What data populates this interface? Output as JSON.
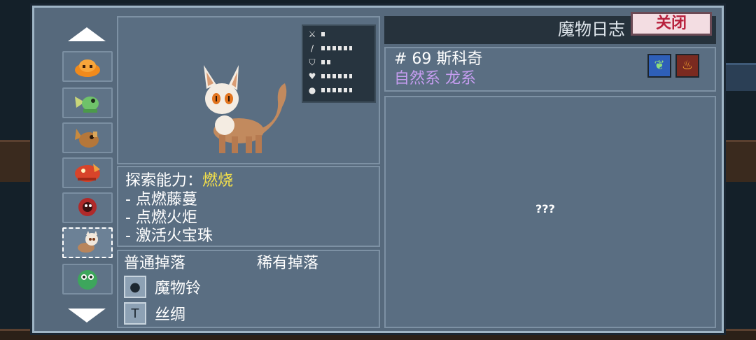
{
  "journal": {
    "title": "魔物日志",
    "close_label": "关闭"
  },
  "sidebar": {
    "monsters": [
      "orange-slime",
      "green-dragon",
      "brown-beast",
      "red-dragon",
      "red-tentacle-beast",
      "cat-monster",
      "green-owl"
    ],
    "selected_index": 5
  },
  "monster": {
    "number_name": "# 69 斯科奇",
    "types": "自然系 龙系",
    "elements": [
      "nature-icon",
      "fire-icon"
    ],
    "stats": [
      {
        "icon": "sword-icon",
        "level": 1
      },
      {
        "icon": "staff-icon",
        "level": 6
      },
      {
        "icon": "shield-icon",
        "level": 2
      },
      {
        "icon": "heart-icon",
        "level": 6
      },
      {
        "icon": "potion-icon",
        "level": 6
      }
    ]
  },
  "ability": {
    "label": "探索能力：",
    "value": "燃烧",
    "items": [
      "- 点燃藤蔓",
      "- 点燃火炬",
      "- 激活火宝珠"
    ]
  },
  "drops": {
    "common_label": "普通掉落",
    "rare_label": "稀有掉落",
    "items": [
      {
        "icon": "bomb-icon",
        "label": "魔物铃"
      },
      {
        "icon": "hammer-icon",
        "label": "丝绸"
      }
    ]
  },
  "map": {
    "unknown": "???"
  }
}
